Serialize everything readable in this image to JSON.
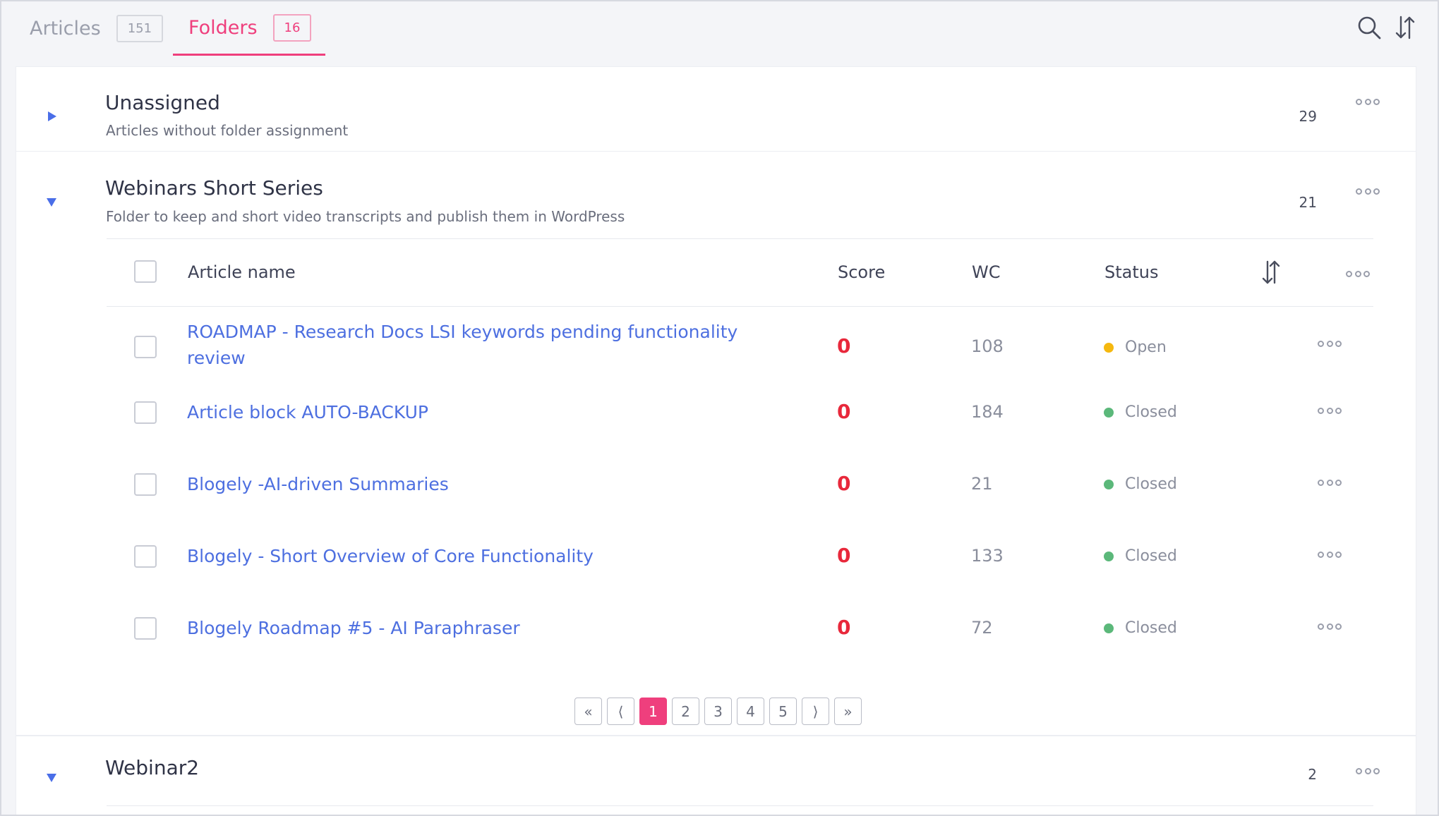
{
  "tabs": {
    "articles": {
      "label": "Articles",
      "count": "151"
    },
    "folders": {
      "label": "Folders",
      "count": "16"
    }
  },
  "toolbar": {
    "search_icon": "search-icon",
    "sort_icon": "sort-icon"
  },
  "folders": [
    {
      "name": "Unassigned",
      "description": "Articles without folder assignment",
      "count": "29",
      "expanded": false
    },
    {
      "name": "Webinars Short Series",
      "description": "Folder to keep and short video transcripts and publish them in WordPress",
      "count": "21",
      "expanded": true,
      "table": {
        "columns": {
          "name": "Article name",
          "score": "Score",
          "wc": "WC",
          "status": "Status"
        },
        "rows": [
          {
            "name": "ROADMAP - Research Docs LSI keywords pending functionality review",
            "score": "0",
            "wc": "108",
            "status": "Open",
            "status_color": "#f5b80f"
          },
          {
            "name": "Article block AUTO-BACKUP",
            "score": "0",
            "wc": "184",
            "status": "Closed",
            "status_color": "#5bb87a"
          },
          {
            "name": "Blogely -AI-driven Summaries",
            "score": "0",
            "wc": "21",
            "status": "Closed",
            "status_color": "#5bb87a"
          },
          {
            "name": "Blogely - Short Overview of Core Functionality",
            "score": "0",
            "wc": "133",
            "status": "Closed",
            "status_color": "#5bb87a"
          },
          {
            "name": "Blogely Roadmap #5 - AI Paraphraser",
            "score": "0",
            "wc": "72",
            "status": "Closed",
            "status_color": "#5bb87a"
          }
        ]
      },
      "pagination": {
        "first": "«",
        "prev": "⟨",
        "pages": [
          "1",
          "2",
          "3",
          "4",
          "5"
        ],
        "current": "1",
        "next": "⟩",
        "last": "»"
      }
    },
    {
      "name": "Webinar2",
      "description": "",
      "count": "2",
      "expanded": true
    }
  ],
  "colors": {
    "accent": "#ef3f7d",
    "link": "#4d6fe0",
    "score": "#e8283b",
    "chevron": "#4a6ee8"
  }
}
